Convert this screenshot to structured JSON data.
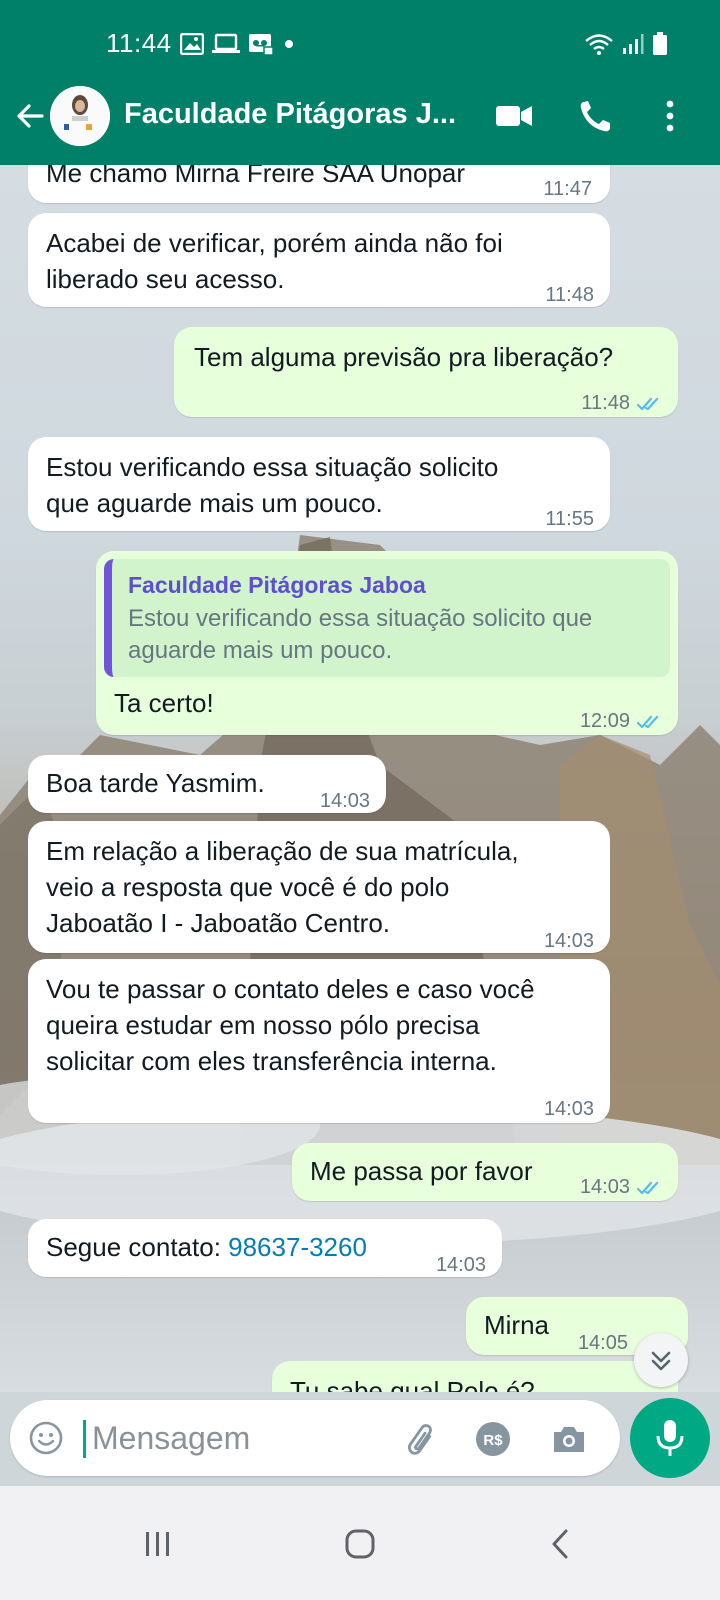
{
  "status_bar": {
    "time": "11:44",
    "icons": [
      "gallery-icon",
      "laptop-icon",
      "voicemail-icon",
      "dot-icon",
      "wifi-icon",
      "signal-icon",
      "battery-icon"
    ]
  },
  "header": {
    "title": "Faculdade Pitágoras J...",
    "back_icon": "arrow-left-icon",
    "actions": [
      "video-call-icon",
      "voice-call-icon",
      "more-vert-icon"
    ]
  },
  "messages": [
    {
      "dir": "in",
      "lines": [
        "Me chamo Mirna Freire SAA Unopar"
      ],
      "time": "11:47"
    },
    {
      "dir": "in",
      "lines": [
        "Acabei de verificar, porém ainda não foi",
        "liberado seu acesso."
      ],
      "time": "11:48"
    },
    {
      "dir": "out",
      "lines": [
        "Tem alguma previsão pra liberação?"
      ],
      "time": "11:48",
      "read": true
    },
    {
      "dir": "in",
      "lines": [
        "Estou verificando essa situação solicito",
        "que aguarde mais um pouco."
      ],
      "time": "11:55"
    },
    {
      "dir": "out",
      "quote": {
        "name": "Faculdade Pitágoras Jaboa",
        "lines": [
          "Estou verificando essa situação solicito que",
          "aguarde mais um pouco."
        ]
      },
      "lines": [
        "Ta certo!"
      ],
      "time": "12:09",
      "read": true
    },
    {
      "dir": "in",
      "lines": [
        "Boa tarde Yasmim."
      ],
      "time": "14:03"
    },
    {
      "dir": "in",
      "lines": [
        "Em relação a liberação de sua matrícula,",
        "veio a resposta que você é do polo",
        "Jaboatão I  - Jaboatão Centro."
      ],
      "time": "14:03"
    },
    {
      "dir": "in",
      "lines": [
        "Vou te passar o contato deles e caso você",
        "queira estudar em nosso pólo precisa",
        "solicitar com eles transferência interna."
      ],
      "time": "14:03"
    },
    {
      "dir": "out",
      "lines": [
        "Me passa por favor"
      ],
      "time": "14:03",
      "read": true
    },
    {
      "dir": "in",
      "prefix": "Segue contato: ",
      "link": "98637-3260",
      "time": "14:03"
    },
    {
      "dir": "out",
      "lines": [
        "Mirna"
      ],
      "time": "14:05"
    },
    {
      "dir": "out",
      "lines": [
        "Tu sabe qual Polo é?"
      ],
      "partial": true
    }
  ],
  "input": {
    "placeholder": "Mensagem",
    "icons": [
      "emoji-icon",
      "attach-icon",
      "payment-icon",
      "camera-icon",
      "mic-icon"
    ]
  },
  "navbar": {
    "buttons": [
      "recent-apps-icon",
      "home-icon",
      "back-icon"
    ]
  },
  "colors": {
    "header": "#008069",
    "incoming": "#ffffff",
    "outgoing": "#e7ffdb",
    "quote_accent": "#6f55d8",
    "link": "#027eb5",
    "read_tick": "#53bdeb",
    "mic_button": "#00a884"
  }
}
